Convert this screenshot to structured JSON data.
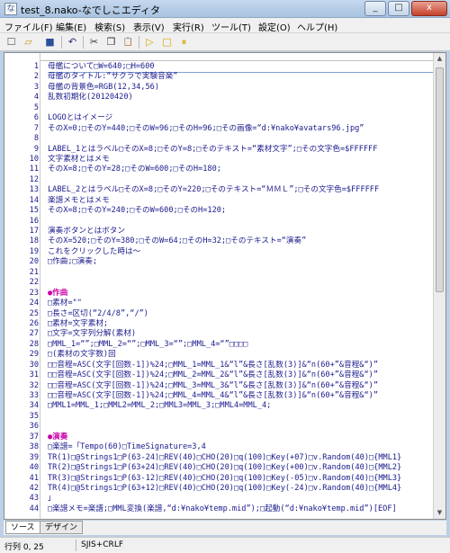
{
  "window": {
    "title": "test_8.nako-なでしこエディタ",
    "minimize": "_",
    "maximize": "□",
    "close": "x"
  },
  "menu": [
    "ファイル(F)",
    "編集(E)",
    "検索(S)",
    "表示(V)",
    "実行(R)",
    "ツール(T)",
    "設定(O)",
    "ヘルプ(H)"
  ],
  "toolbar": {
    "buttons": [
      "new-icon",
      "open-icon",
      "save-icon",
      "undo-icon",
      "cut-icon",
      "copy-icon",
      "paste-icon",
      "run-icon",
      "stop-icon",
      "pause-icon"
    ],
    "glyphs": [
      "☐",
      "▱",
      "■",
      "↶",
      "✂",
      "❐",
      "📋",
      "▷",
      "□",
      "⏸"
    ]
  },
  "editor": {
    "lines": [
      {
        "n": "1",
        "t": "母艦について□W=640;□H=600",
        "kind": "cursor"
      },
      {
        "n": "2",
        "t": "母艦のタイトル:“サクラで実験音楽”",
        "kind": ""
      },
      {
        "n": "3",
        "t": "母艦の背景色=RGB(12,34,56)",
        "kind": ""
      },
      {
        "n": "4",
        "t": "乱数初期化(20120420)",
        "kind": ""
      },
      {
        "n": "5",
        "t": "",
        "kind": ""
      },
      {
        "n": "6",
        "t": "LOGOとはイメージ",
        "kind": ""
      },
      {
        "n": "7",
        "t": "そのX=0;□そのY=440;□そのW=96;□そのH=96;□その画像=“d:¥nako¥avatars96.jpg”",
        "kind": ""
      },
      {
        "n": "8",
        "t": "",
        "kind": ""
      },
      {
        "n": "9",
        "t": "LABEL_1とはラベル□そのX=8;□そのY=8;□そのテキスト=“素材文字”;□その文字色=$FFFFFF",
        "kind": ""
      },
      {
        "n": "10",
        "t": "文字素材とはメモ",
        "kind": ""
      },
      {
        "n": "11",
        "t": "そのX=8;□そのY=28;□そのW=600;□そのH=180;",
        "kind": ""
      },
      {
        "n": "12",
        "t": "",
        "kind": ""
      },
      {
        "n": "13",
        "t": "LABEL_2とはラベル□そのX=8;□そのY=220;□そのテキスト=“ＭＭＬ”;□その文字色=$FFFFFF",
        "kind": ""
      },
      {
        "n": "14",
        "t": "楽譜メモとはメモ",
        "kind": ""
      },
      {
        "n": "15",
        "t": "そのX=8;□そのY=240;□そのW=600;□そのH=120;",
        "kind": ""
      },
      {
        "n": "16",
        "t": "",
        "kind": ""
      },
      {
        "n": "17",
        "t": "演奏ボタンとはボタン",
        "kind": ""
      },
      {
        "n": "18",
        "t": "そのX=520;□そのY=380;□そのW=64;□そのH=32;□そのテキスト=“演奏”",
        "kind": ""
      },
      {
        "n": "19",
        "t": "これをクリックした時は～",
        "kind": ""
      },
      {
        "n": "20",
        "t": "□作曲;□演奏;",
        "kind": ""
      },
      {
        "n": "21",
        "t": "",
        "kind": ""
      },
      {
        "n": "22",
        "t": "",
        "kind": ""
      },
      {
        "n": "23",
        "t": "●作曲",
        "kind": "heading"
      },
      {
        "n": "24",
        "t": "□素材=\"\"",
        "kind": ""
      },
      {
        "n": "25",
        "t": "□長さ=区切(“2/4/8”,“/”)",
        "kind": ""
      },
      {
        "n": "26",
        "t": "□素材=文字素材;",
        "kind": ""
      },
      {
        "n": "27",
        "t": "□文字=文字列分解(素材)",
        "kind": ""
      },
      {
        "n": "28",
        "t": "□MML_1=“”;□MML_2=“”;□MML_3=“”;□MML_4=“”□□□□",
        "kind": ""
      },
      {
        "n": "29",
        "t": "□(素材の文字数)回",
        "kind": ""
      },
      {
        "n": "30",
        "t": "□□音程=ASC(文字[回数-1])%24;□MML_1=MML_1&“l”&長さ[乱数(3)]&“n(60+”&音程&“)”",
        "kind": ""
      },
      {
        "n": "31",
        "t": "□□音程=ASC(文字[回数-1])%24;□MML_2=MML_2&“l”&長さ[乱数(3)]&“n(60+”&音程&“)”",
        "kind": ""
      },
      {
        "n": "32",
        "t": "□□音程=ASC(文字[回数-1])%24;□MML_3=MML_3&“l”&長さ[乱数(3)]&“n(60+”&音程&“)”",
        "kind": ""
      },
      {
        "n": "33",
        "t": "□□音程=ASC(文字[回数-1])%24;□MML_4=MML_4&“l”&長さ[乱数(3)]&“n(60+”&音程&“)”",
        "kind": ""
      },
      {
        "n": "34",
        "t": "□MML1=MML_1;□MML2=MML_2;□MML3=MML_3;□MML4=MML_4;",
        "kind": ""
      },
      {
        "n": "35",
        "t": "",
        "kind": ""
      },
      {
        "n": "36",
        "t": "",
        "kind": ""
      },
      {
        "n": "37",
        "t": "●演奏",
        "kind": "heading"
      },
      {
        "n": "38",
        "t": "□楽譜=「Tempo(60)□TimeSignature=3,4",
        "kind": ""
      },
      {
        "n": "39",
        "t": "TR(1)□@Strings1□P(63-24)□REV(40)□CHO(20)□q(100)□Key(+07)□v.Random(40)□{MML1}",
        "kind": ""
      },
      {
        "n": "40",
        "t": "TR(2)□@Strings1□P(63+24)□REV(40)□CHO(20)□q(100)□Key(+00)□v.Random(40)□{MML2}",
        "kind": ""
      },
      {
        "n": "41",
        "t": "TR(3)□@Strings1□P(63-12)□REV(40)□CHO(20)□q(100)□Key(-05)□v.Random(40)□{MML3}",
        "kind": ""
      },
      {
        "n": "42",
        "t": "TR(4)□@Strings1□P(63+12)□REV(40)□CHO(20)□q(100)□Key(-24)□v.Random(40)□{MML4}",
        "kind": ""
      },
      {
        "n": "43",
        "t": "」",
        "kind": ""
      },
      {
        "n": "44",
        "t": "□楽譜メモ=楽譜;□MML変換(楽譜,“d:¥nako¥temp.mid”);□起動(“d:¥nako¥temp.mid”)[EOF]",
        "kind": ""
      }
    ]
  },
  "tabs": {
    "source": "ソース",
    "design": "デザイン"
  },
  "status": {
    "position": "行列  0, 25",
    "encoding": "SJIS+CRLF"
  },
  "colors": {
    "code": "#1a1a8c",
    "heading": "#c800a8"
  }
}
